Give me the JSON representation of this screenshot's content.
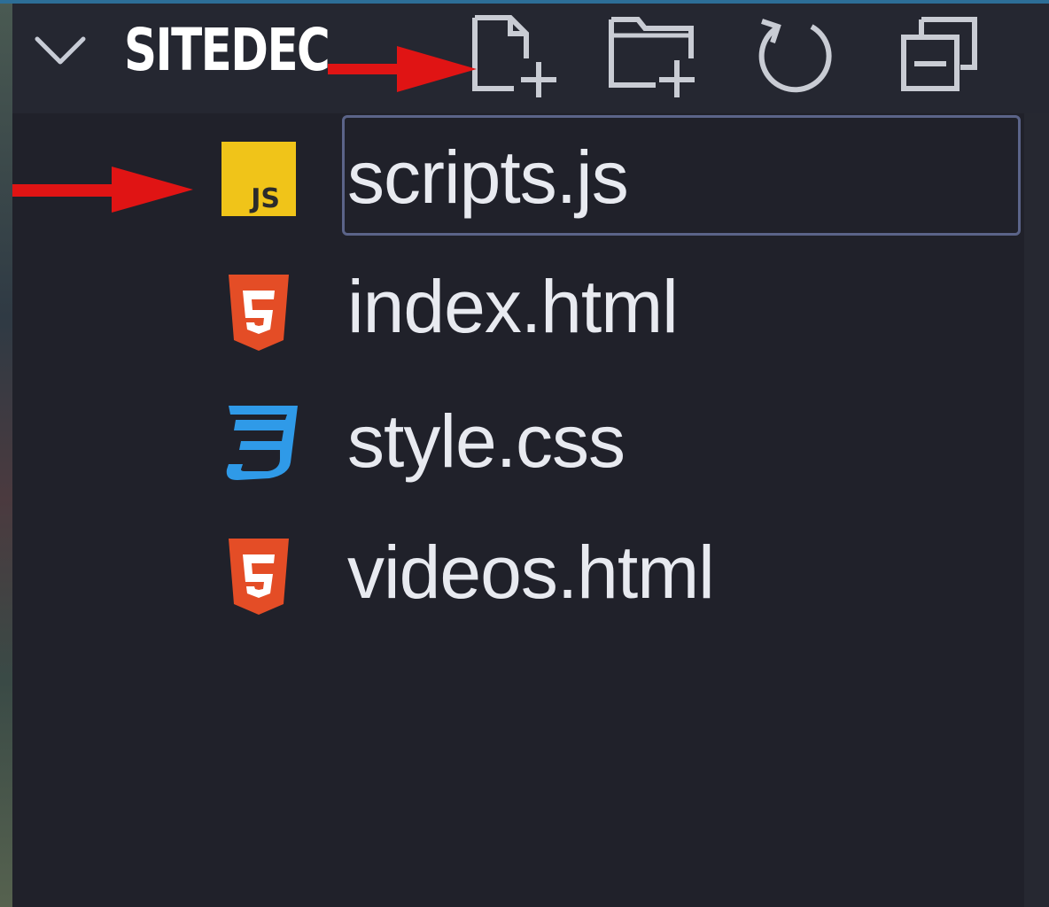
{
  "explorer": {
    "folder_title": "SITEDEC",
    "toolbar": {
      "new_file_icon": "new-file-icon",
      "new_folder_icon": "new-folder-icon",
      "refresh_icon": "refresh-icon",
      "collapse_icon": "collapse-all-icon"
    },
    "files": [
      {
        "name": "scripts.js",
        "icon": "javascript-file-icon",
        "selected": true
      },
      {
        "name": "index.html",
        "icon": "html5-file-icon",
        "selected": false
      },
      {
        "name": "style.css",
        "icon": "css3-file-icon",
        "selected": false
      },
      {
        "name": "videos.html",
        "icon": "html5-file-icon",
        "selected": false
      }
    ]
  },
  "annotations": {
    "arrow_color": "#e01414",
    "arrows": [
      "points-to-new-file-button",
      "points-to-scripts-js"
    ]
  },
  "colors": {
    "panel_bg": "#20212a",
    "header_bg": "#252731",
    "focus_border": "#5b6489",
    "js_yellow": "#f0c419",
    "html_orange": "#e44d26",
    "css_blue": "#2f9ae8"
  }
}
